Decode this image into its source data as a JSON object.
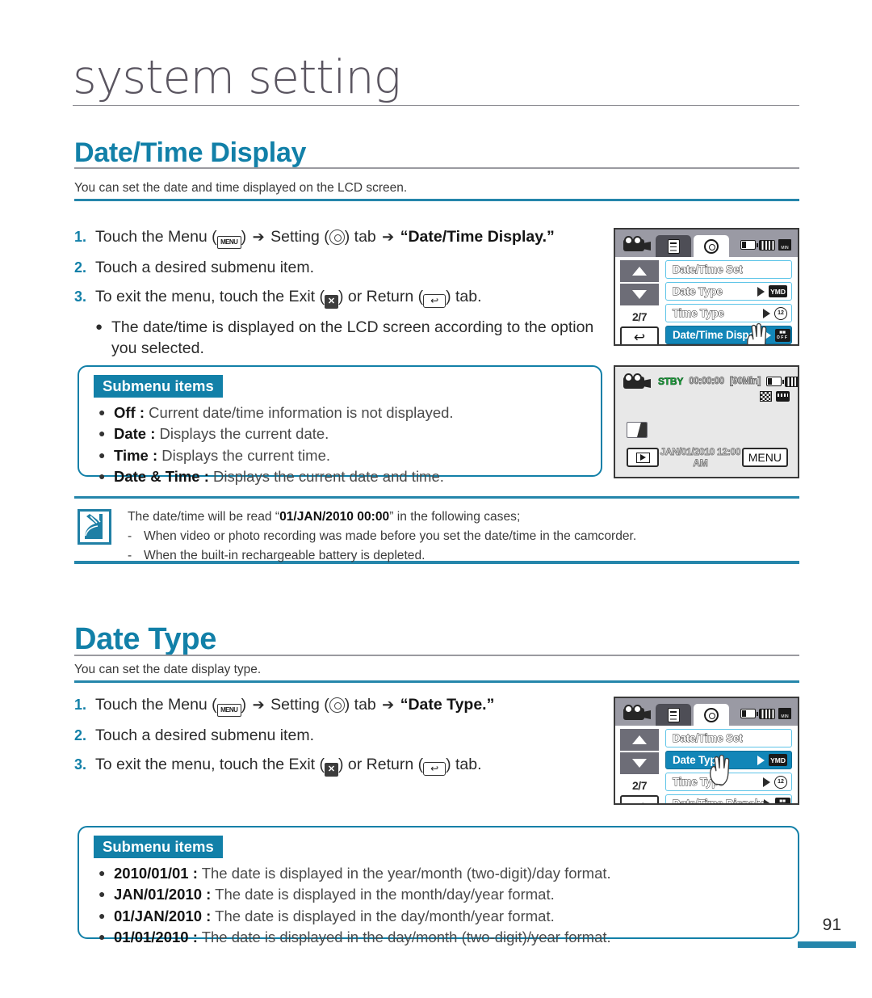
{
  "page": {
    "chapter_title": "system setting",
    "number": "91"
  },
  "sections": [
    {
      "heading": "Date/Time Display",
      "subtitle": "You can set the date and time displayed on the LCD screen.",
      "steps": [
        {
          "num": "1.",
          "pre": "Touch the Menu (",
          "menu_icon": "MENU",
          "mid": ") ",
          "arrow": "➔",
          "setting_word": " Setting (",
          "gear_icon": "gear-icon",
          "post": ") tab ",
          "arrow2": "➔",
          "target": "“Date/Time Display.”"
        },
        {
          "num": "2.",
          "text": "Touch a desired submenu item."
        },
        {
          "num": "3.",
          "pre": "To exit the menu, touch the Exit (",
          "exit_icon": "✕",
          "mid": ") or Return (",
          "return_icon": "↩",
          "post": ") tab."
        }
      ],
      "sub_bullet": "The date/time is displayed on the LCD screen according to the option you selected.",
      "submenu": {
        "tag": "Submenu items",
        "items": [
          {
            "label": "Off :",
            "desc": "Current date/time information is not displayed."
          },
          {
            "label": "Date :",
            "desc": "Displays the current date."
          },
          {
            "label": "Time :",
            "desc": "Displays the current time."
          },
          {
            "label": "Date & Time :",
            "desc": "Displays the current date and time."
          }
        ]
      }
    },
    {
      "heading": "Date Type",
      "subtitle": "You can set the date display type.",
      "steps": [
        {
          "num": "1.",
          "target": "“Date Type.”"
        },
        {
          "num": "2.",
          "text": "Touch a desired submenu item."
        },
        {
          "num": "3."
        }
      ],
      "submenu": {
        "tag": "Submenu items",
        "items": [
          {
            "label": "2010/01/01 :",
            "desc": "The date is displayed in the year/month (two-digit)/day format."
          },
          {
            "label": "JAN/01/2010 :",
            "desc": "The date is displayed in the month/day/year format."
          },
          {
            "label": "01/JAN/2010 :",
            "desc": "The date is displayed in the day/month/year format."
          },
          {
            "label": "01/01/2010 :",
            "desc": "The date is displayed in the day/month (two-digit)/year format."
          }
        ]
      }
    }
  ],
  "note": {
    "lead_pre": "The date/time will be read “",
    "lead_bold": "01/JAN/2010 00:00",
    "lead_post": "” in the following cases;",
    "items": [
      "When video or photo recording was made before you set the date/time in the camcorder.",
      "When the built-in rechargeable battery is depleted."
    ]
  },
  "lcd_menu_a": {
    "page_indicator": "2/7",
    "return_glyph": "↩",
    "rows": [
      {
        "label": "Date/Time Set",
        "selected": false,
        "badge": ""
      },
      {
        "label": "Date Type",
        "selected": false,
        "badge": "YMD"
      },
      {
        "label": "Time Type",
        "selected": false,
        "badge": "clock"
      },
      {
        "label": "Date/Time Dispaly",
        "selected": true,
        "badge": "cal"
      }
    ]
  },
  "lcd_menu_b": {
    "page_indicator": "2/7",
    "return_glyph": "↩",
    "rows": [
      {
        "label": "Date/Time Set",
        "selected": false,
        "badge": ""
      },
      {
        "label": "Date Type",
        "selected": true,
        "badge": "YMD"
      },
      {
        "label": "Time Type",
        "selected": false,
        "badge": "clock"
      },
      {
        "label": "Date/Time Dispaly",
        "selected": false,
        "badge": "cal"
      }
    ]
  },
  "lcd_record": {
    "status": "STBY",
    "timecode": "00:00:00",
    "remaining": "[90Min]",
    "datetime": "JAN/01/2010 12:00 AM",
    "menu_label": "MENU"
  },
  "colors": {
    "accent": "#1280a8",
    "rule": "#2586ab",
    "lcd_select": "#1286b8",
    "lcd_border": "#5fc5e8",
    "stby_green": "#19a13a"
  }
}
